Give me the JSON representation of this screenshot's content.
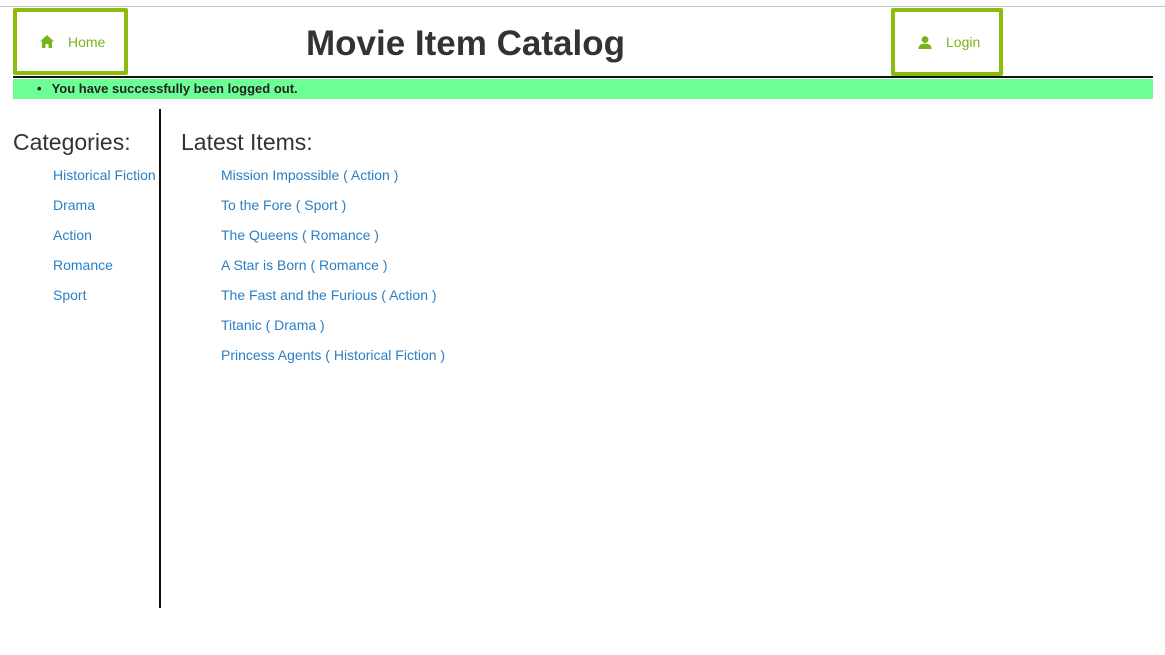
{
  "header": {
    "title": "Movie Item Catalog",
    "home_label": "Home",
    "login_label": "Login"
  },
  "flash": {
    "message": "You have successfully been logged out."
  },
  "sidebar": {
    "heading": "Categories:",
    "items": [
      {
        "label": "Historical Fiction"
      },
      {
        "label": "Drama"
      },
      {
        "label": "Action"
      },
      {
        "label": "Romance"
      },
      {
        "label": "Sport"
      }
    ]
  },
  "main": {
    "heading": "Latest Items:",
    "items": [
      {
        "label": "Mission Impossible ( Action )"
      },
      {
        "label": "To the Fore ( Sport )"
      },
      {
        "label": "The Queens ( Romance )"
      },
      {
        "label": "A Star is Born ( Romance )"
      },
      {
        "label": "The Fast and the Furious ( Action )"
      },
      {
        "label": "Titanic ( Drama )"
      },
      {
        "label": "Princess Agents ( Historical Fiction )"
      }
    ]
  },
  "colors": {
    "accent_green": "#8cbc0e",
    "nav_text": "#7ab317",
    "flash_bg": "#6cff96",
    "link": "#2a7fc4"
  },
  "icons": {
    "home": "home-icon",
    "login": "user-icon"
  }
}
